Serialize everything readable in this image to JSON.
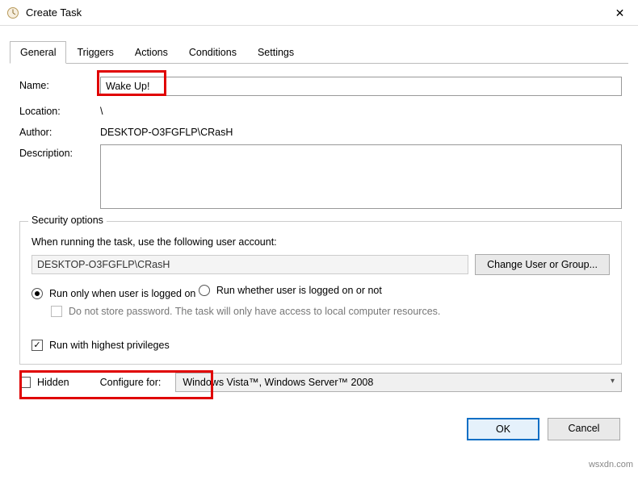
{
  "window": {
    "title": "Create Task",
    "close_glyph": "✕"
  },
  "tabs": [
    "General",
    "Triggers",
    "Actions",
    "Conditions",
    "Settings"
  ],
  "labels": {
    "name": "Name:",
    "location": "Location:",
    "author": "Author:",
    "description": "Description:",
    "security_options": "Security options",
    "when_running": "When running the task, use the following user account:",
    "change_user": "Change User or Group...",
    "run_only_logged": "Run only when user is logged on",
    "run_whether": "Run whether user is logged on or not",
    "do_not_store": "Do not store password.  The task will only have access to local computer resources.",
    "run_highest": "Run with highest privileges",
    "hidden": "Hidden",
    "configure_for": "Configure for:",
    "ok": "OK",
    "cancel": "Cancel"
  },
  "values": {
    "name": "Wake Up!",
    "location": "\\",
    "author": "DESKTOP-O3FGFLP\\CRasH",
    "description": "",
    "user_account": "DESKTOP-O3FGFLP\\CRasH",
    "configure_for": "Windows Vista™, Windows Server™ 2008"
  },
  "state": {
    "run_option": "logged_on",
    "do_not_store": false,
    "run_highest": true,
    "hidden": false
  },
  "watermark": "wsxdn.com"
}
